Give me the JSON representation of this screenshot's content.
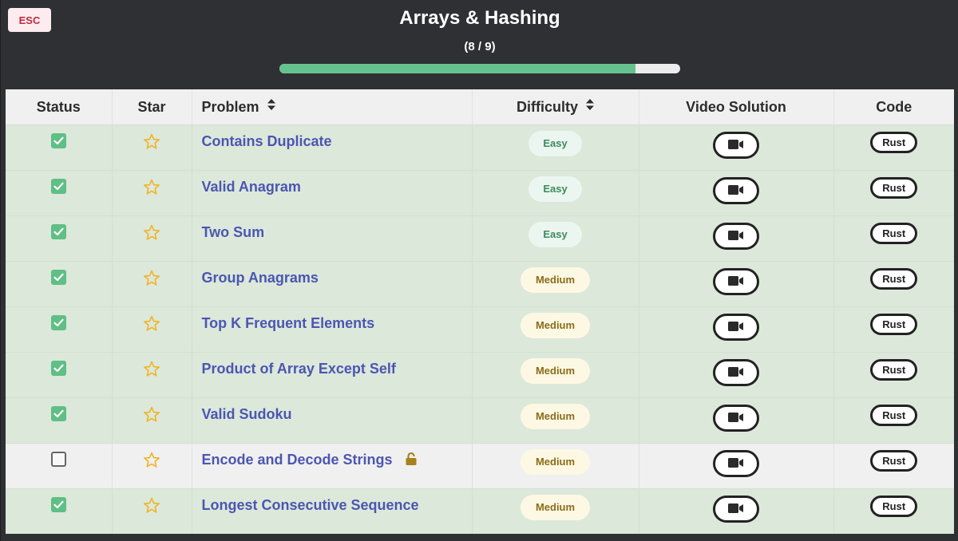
{
  "header": {
    "esc_label": "ESC",
    "title": "Arrays & Hashing",
    "count_text": "(8 / 9)",
    "progress": {
      "completed": 8,
      "total": 9,
      "fraction": 0.889
    }
  },
  "colors": {
    "accent_green": "#65c28e",
    "link_blue": "#4b56b2",
    "easy_text": "#3f8a5c",
    "medium_text": "#8a6d1a",
    "star_gold": "#f0b429",
    "esc_red": "#c0283f"
  },
  "table": {
    "columns": [
      {
        "label": "Status",
        "sortable": false
      },
      {
        "label": "Star",
        "sortable": false
      },
      {
        "label": "Problem",
        "sortable": true
      },
      {
        "label": "Difficulty",
        "sortable": true
      },
      {
        "label": "Video Solution",
        "sortable": false
      },
      {
        "label": "Code",
        "sortable": false
      }
    ],
    "rows": [
      {
        "status": "checked",
        "starred": false,
        "problem": "Contains Duplicate",
        "locked": false,
        "difficulty": "Easy",
        "video_icon": "video-camera-icon",
        "code": "Rust"
      },
      {
        "status": "checked",
        "starred": false,
        "problem": "Valid Anagram",
        "locked": false,
        "difficulty": "Easy",
        "video_icon": "video-camera-icon",
        "code": "Rust"
      },
      {
        "status": "checked",
        "starred": false,
        "problem": "Two Sum",
        "locked": false,
        "difficulty": "Easy",
        "video_icon": "video-camera-icon",
        "code": "Rust"
      },
      {
        "status": "checked",
        "starred": false,
        "problem": "Group Anagrams",
        "locked": false,
        "difficulty": "Medium",
        "video_icon": "video-camera-icon",
        "code": "Rust"
      },
      {
        "status": "checked",
        "starred": false,
        "problem": "Top K Frequent Elements",
        "locked": false,
        "difficulty": "Medium",
        "video_icon": "video-camera-icon",
        "code": "Rust"
      },
      {
        "status": "checked",
        "starred": false,
        "problem": "Product of Array Except Self",
        "locked": false,
        "difficulty": "Medium",
        "video_icon": "video-camera-icon",
        "code": "Rust"
      },
      {
        "status": "checked",
        "starred": false,
        "problem": "Valid Sudoku",
        "locked": false,
        "difficulty": "Medium",
        "video_icon": "video-camera-icon",
        "code": "Rust"
      },
      {
        "status": "unchecked",
        "starred": false,
        "problem": "Encode and Decode Strings",
        "locked": true,
        "lock_icon": "unlock-icon",
        "difficulty": "Medium",
        "video_icon": "video-camera-icon",
        "code": "Rust"
      },
      {
        "status": "checked",
        "starred": false,
        "problem": "Longest Consecutive Sequence",
        "locked": false,
        "difficulty": "Medium",
        "video_icon": "video-camera-icon",
        "code": "Rust"
      }
    ]
  }
}
